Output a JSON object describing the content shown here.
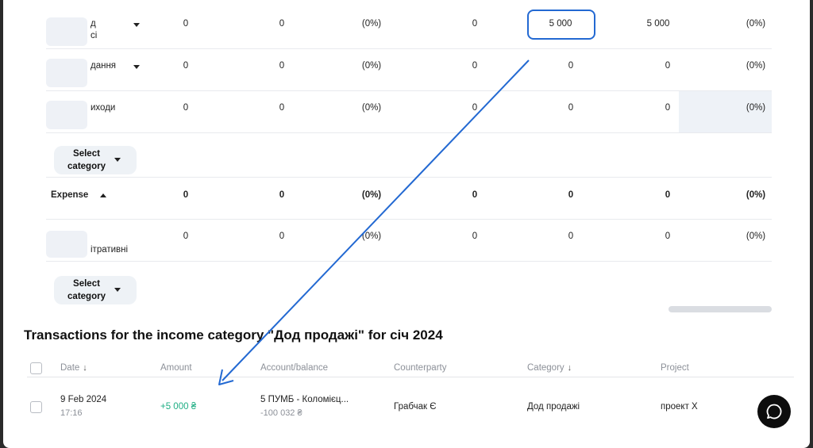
{
  "budget_table": {
    "rows": [
      {
        "label_line1": "д",
        "label_line2": "сі",
        "values": [
          "0",
          "0",
          "(0%)",
          "0",
          "5 000",
          "5 000",
          "(0%)"
        ],
        "bold": false
      },
      {
        "label_line1": "дання",
        "label_line2": "",
        "values": [
          "0",
          "0",
          "(0%)",
          "0",
          "0",
          "0",
          "(0%)"
        ],
        "bold": false
      },
      {
        "label_line1": "иходи",
        "label_line2": "",
        "values": [
          "0",
          "0",
          "(0%)",
          "0",
          "0",
          "0",
          "(0%)"
        ],
        "bold": false
      },
      {
        "label_line1": "Expense",
        "label_line2": "",
        "values": [
          "0",
          "0",
          "(0%)",
          "0",
          "0",
          "0",
          "(0%)"
        ],
        "bold": true
      },
      {
        "label_line1": "",
        "label_line2": "ітративні",
        "values": [
          "0",
          "0",
          "(0%)",
          "0",
          "0",
          "0",
          "(0%)"
        ],
        "bold": false
      }
    ],
    "select_category_label": "Select category",
    "highlighted_value": "5 000"
  },
  "transactions": {
    "title": "Transactions for the income category \"Дод продажі\" for січ 2024",
    "headers": {
      "date": "Date",
      "amount": "Amount",
      "account": "Account/balance",
      "counterparty": "Counterparty",
      "category": "Category",
      "project": "Project"
    },
    "sort_arrow": "↓",
    "rows": [
      {
        "date": "9 Feb 2024",
        "time": "17:16",
        "amount": "+5 000 ₴",
        "account": "5 ПУМБ - Коломієц...",
        "balance": "-100 032 ₴",
        "counterparty": "Грабчак Є",
        "category": "Дод продажі",
        "project": "проект Х"
      }
    ]
  },
  "colors": {
    "accent_blue": "#2369d2",
    "amount_green": "#1fae84",
    "chat_button": "#0d0d0d"
  },
  "icons": [
    "caret-down-icon",
    "caret-up-icon",
    "sort-arrow-icon",
    "checkbox-icon",
    "chat-icon"
  ]
}
